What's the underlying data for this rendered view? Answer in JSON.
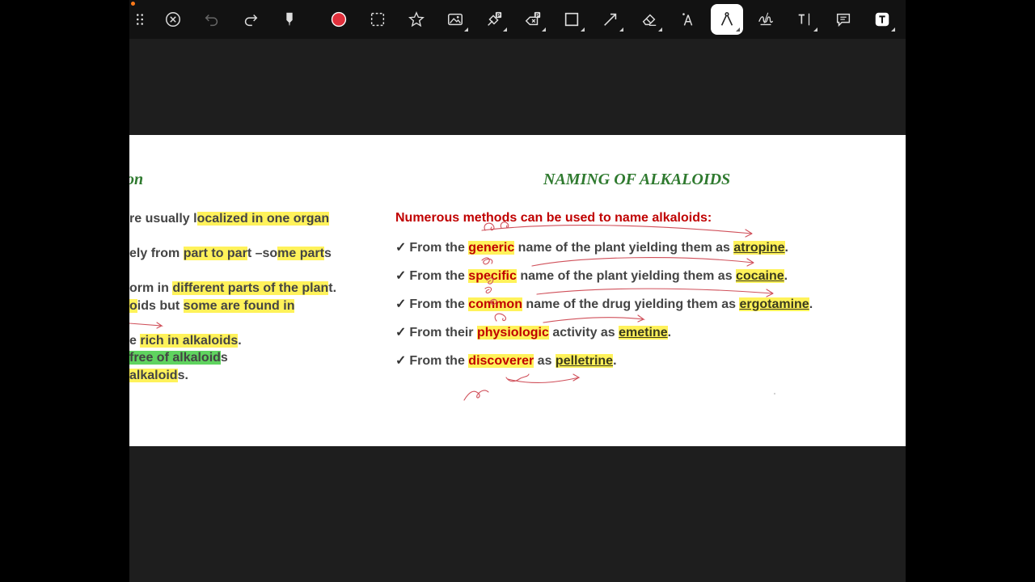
{
  "toolbar": {
    "tools": [
      {
        "name": "grid-handle",
        "label": "Toolbar handle"
      },
      {
        "name": "close",
        "label": "Close"
      },
      {
        "name": "undo",
        "label": "Undo"
      },
      {
        "name": "redo",
        "label": "Redo"
      },
      {
        "name": "pen",
        "label": "Pen"
      },
      {
        "name": "color",
        "label": "Color",
        "color": "#e0303c"
      },
      {
        "name": "lasso-select",
        "label": "Lasso selection"
      },
      {
        "name": "favorite",
        "label": "Favorites"
      },
      {
        "name": "image",
        "label": "Insert image"
      },
      {
        "name": "highlighter-p",
        "label": "Highlighter"
      },
      {
        "name": "eraser-p",
        "label": "Eraser"
      },
      {
        "name": "shape",
        "label": "Shapes"
      },
      {
        "name": "line",
        "label": "Line"
      },
      {
        "name": "eraser",
        "label": "Eraser"
      },
      {
        "name": "laser",
        "label": "Laser pointer"
      },
      {
        "name": "compass",
        "label": "Compass",
        "active": true
      },
      {
        "name": "handwriting",
        "label": "Handwriting"
      },
      {
        "name": "text-cursor",
        "label": "Text"
      },
      {
        "name": "comment",
        "label": "Comment"
      },
      {
        "name": "text-box",
        "label": "Text box"
      }
    ],
    "accent_color": "#ff7a1a"
  },
  "left_slide": {
    "title_fragment": "on",
    "lines": [
      [
        {
          "t": "re usually l"
        },
        {
          "t": "ocalized in one organ",
          "h": "hl"
        }
      ],
      [
        {
          "t": "ely from "
        },
        {
          "t": "part to par",
          "h": "hl"
        },
        {
          "t": "t –so"
        },
        {
          "t": "me part",
          "h": "hl"
        },
        {
          "t": "s"
        }
      ],
      [
        {
          "t": "orm in "
        },
        {
          "t": "different parts of the plan",
          "h": "hl"
        },
        {
          "t": "t."
        }
      ],
      [
        {
          "t": "o",
          "h": "hl"
        },
        {
          "t": "ids but "
        },
        {
          "t": "some are found in",
          "h": "hl"
        }
      ],
      [
        {
          "t": "e "
        },
        {
          "t": "rich in alkaloids",
          "h": "hl"
        },
        {
          "t": "."
        }
      ],
      [
        {
          "t": "free of alkaloid",
          "h": "hl-g"
        },
        {
          "t": "s"
        }
      ],
      [
        {
          "t": "alkaloid",
          "h": "hl"
        },
        {
          "t": "s."
        }
      ]
    ]
  },
  "right_slide": {
    "title": "NAMING OF ALKALOIDS",
    "intro": "Numerous methods can be used to name alkaloids:",
    "check": "✓",
    "bullets": [
      {
        "pre": "From the ",
        "key": "generic",
        "post": " name of the plant yielding them as ",
        "example": "atropine",
        "end": "."
      },
      {
        "pre": "From the ",
        "key": "specific",
        "post": " name of the plant yielding them as ",
        "example": "cocaine",
        "end": "."
      },
      {
        "pre": "From the ",
        "key": "common",
        "post": " name of the drug yielding them as ",
        "example": "ergotamine",
        "end": "."
      },
      {
        "pre": "From their ",
        "key": "physiologic",
        "post": " activity as ",
        "example": "emetine",
        "end": "."
      },
      {
        "pre": "From the ",
        "key": "discoverer",
        "post": " as ",
        "example": "pelletrine",
        "end": "."
      }
    ]
  },
  "colors": {
    "title_green": "#2f7a2f",
    "emphasis_red": "#c00000",
    "highlight_yellow": "#fff25a",
    "highlight_green": "#5fd35f",
    "ink_red": "#d0505a"
  }
}
